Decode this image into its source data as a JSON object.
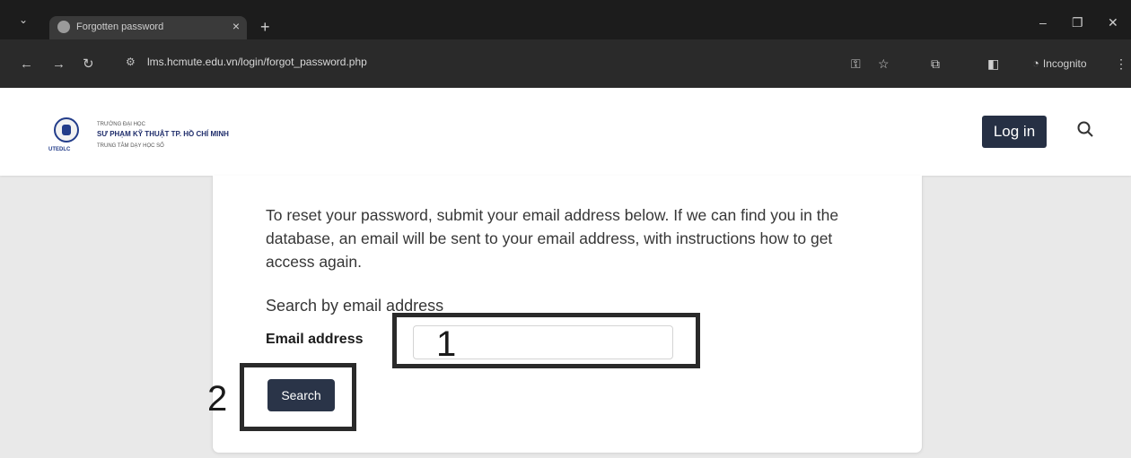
{
  "browser": {
    "tab_title": "Forgotten password",
    "tab_close": "×",
    "new_tab": "+",
    "url": "lms.hcmute.edu.vn/login/forgot_password.php",
    "incognito_label": "Incognito",
    "window_controls": [
      "–",
      "❐",
      "✕"
    ]
  },
  "header": {
    "logo_caption": "UTEDLC",
    "logo_line1": "TRƯỜNG ĐẠI HỌC",
    "logo_line2": "SƯ PHẠM KỸ THUẬT TP. HỒ CHÍ MINH",
    "logo_line3": "TRUNG TÂM DẠY HỌC SỐ",
    "login_label": "Log in"
  },
  "form": {
    "instructions": "To reset your password, submit your email address below. If we can find you in the database, an email will be sent to your email address, with instructions how to get access again.",
    "section_heading": "Search by email address",
    "email_label": "Email address",
    "email_value": "",
    "search_label": "Search"
  },
  "annotations": {
    "marker_1": "1",
    "marker_2": "2"
  },
  "colors": {
    "chrome_dark": "#1c1c1c",
    "button_dark": "#263044",
    "brand_blue": "#233d8a"
  }
}
